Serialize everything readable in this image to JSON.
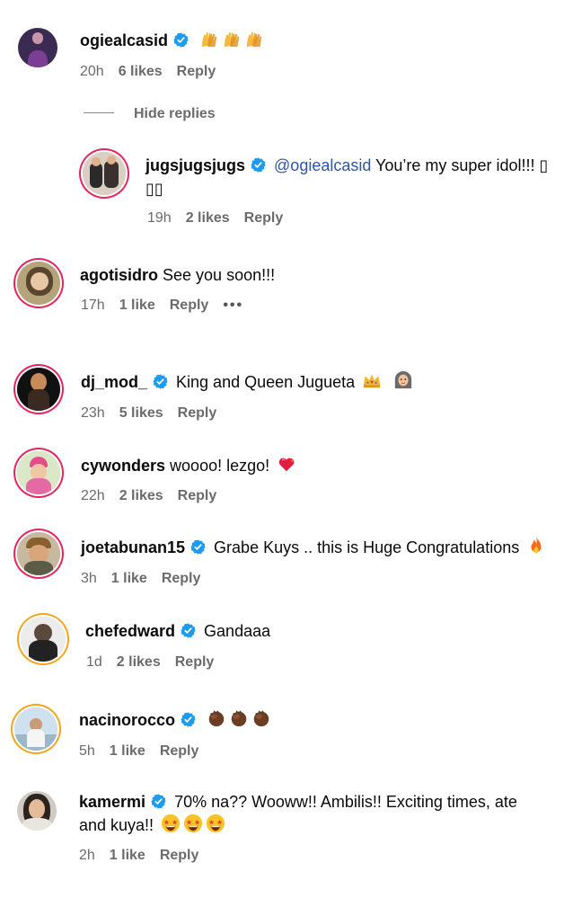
{
  "hide_replies": "Hide replies",
  "comments": [
    {
      "username": "ogiealcasid",
      "verified": true,
      "mention": "",
      "text": "",
      "emoji": "raising-hands x3",
      "time": "20h",
      "likes": "6 likes",
      "reply": "Reply"
    },
    {
      "username": "jugsjugsjugs",
      "verified": true,
      "mention": "@ogiealcasid",
      "text": " You’re my super idol!!! ▯",
      "text2": "▯▯",
      "time": "19h",
      "likes": "2 likes",
      "reply": "Reply"
    },
    {
      "username": "agotisidro",
      "verified": false,
      "mention": "",
      "text": " See you soon!!!",
      "time": "17h",
      "likes": "1 like",
      "reply": "Reply",
      "more": "•••"
    },
    {
      "username": "dj_mod_",
      "verified": true,
      "mention": "",
      "text": "King and Queen Jugueta",
      "emoji": "crown, woman-with-headscarf",
      "time": "23h",
      "likes": "5 likes",
      "reply": "Reply"
    },
    {
      "username": "cywonders",
      "verified": false,
      "mention": "",
      "text": " woooo! lezgo!",
      "emoji": "heart-on-fire",
      "time": "22h",
      "likes": "2 likes",
      "reply": "Reply"
    },
    {
      "username": "joetabunan15",
      "verified": true,
      "mention": "",
      "text": "Grabe Kuys .. this is Huge Congratulations",
      "emoji": "fire",
      "time": "3h",
      "likes": "1 like",
      "reply": "Reply"
    },
    {
      "username": "chefedward",
      "verified": true,
      "mention": "",
      "text": "Gandaaa",
      "time": "1d",
      "likes": "2 likes",
      "reply": "Reply"
    },
    {
      "username": "nacinorocco",
      "verified": true,
      "mention": "",
      "text": "",
      "emoji": "clapping-hands x3",
      "time": "5h",
      "likes": "1 like",
      "reply": "Reply"
    },
    {
      "username": "kamermi",
      "verified": true,
      "mention": "",
      "text": "70% na?? Wooww!! Ambilis!! Exciting times, ate",
      "text2": "and kuya!!",
      "emoji": "star-struck x3",
      "time": "2h",
      "likes": "1 like",
      "reply": "Reply"
    }
  ],
  "colors": {
    "verified": "#1d9bf0",
    "mention": "#2d55a8",
    "meta": "#6b6b6b",
    "ring": "#e6245d"
  }
}
